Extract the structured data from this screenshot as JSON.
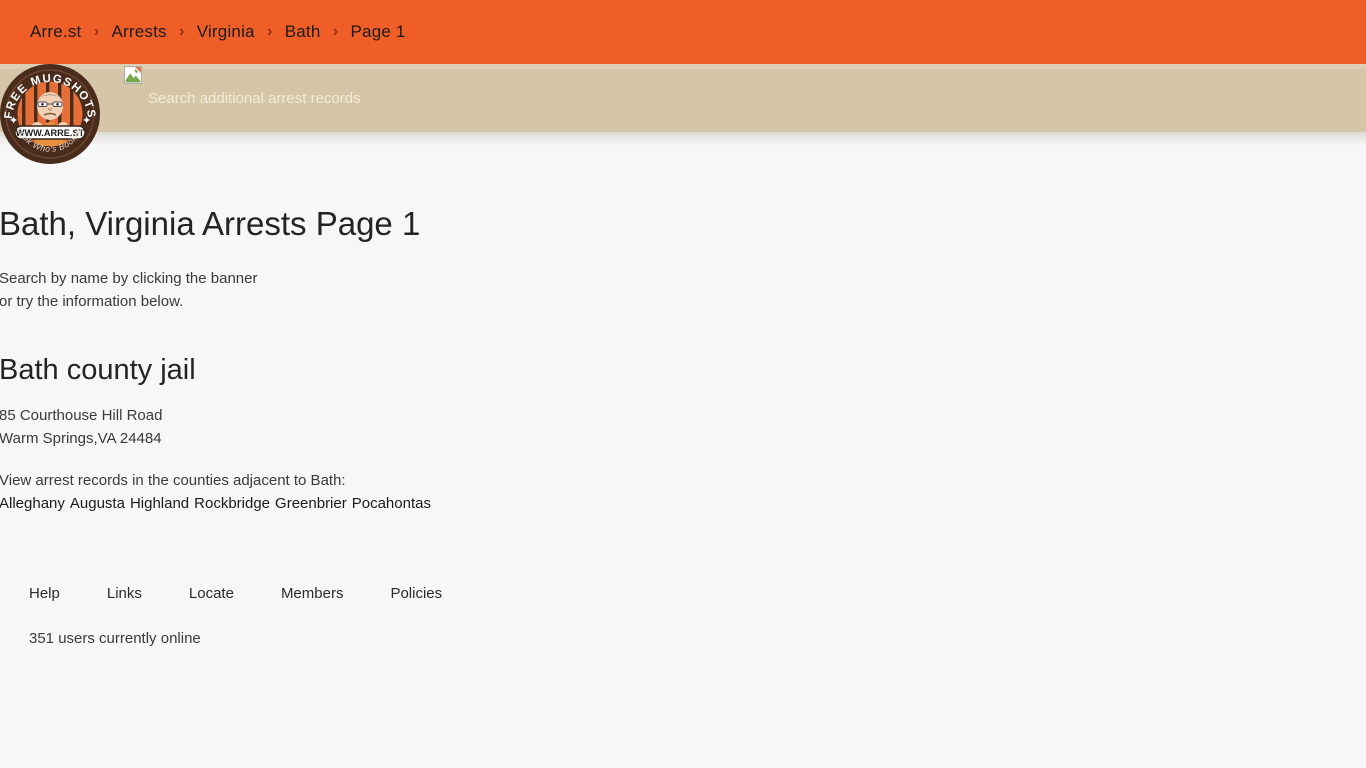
{
  "breadcrumb": {
    "separator": "›",
    "items": [
      {
        "label": "Arre.st"
      },
      {
        "label": "Arrests"
      },
      {
        "label": "Virginia"
      },
      {
        "label": "Bath"
      },
      {
        "label": "Page 1"
      }
    ]
  },
  "banner": {
    "alt_text": "Search additional arrest records",
    "icon": "broken-image-icon"
  },
  "logo": {
    "top_text": "FREE MUGSHOTS",
    "url_text": "WWW.ARRE.ST",
    "tagline": "Look Who's Booked"
  },
  "main": {
    "page_title": "Bath, Virginia Arrests Page 1",
    "lead_line_1": "Search by name by clicking the banner",
    "lead_line_2": "or try the information below.",
    "jail_name": "Bath county jail",
    "address_line_1": "85 Courthouse Hill Road",
    "address_line_2": "Warm Springs,VA 24484",
    "adjacent_label": "View arrest records in the counties adjacent to Bath:",
    "adjacent_counties": [
      "Alleghany",
      "Augusta",
      "Highland",
      "Rockbridge",
      "Greenbrier",
      "Pocahontas"
    ]
  },
  "footer": {
    "links": [
      {
        "label": "Help"
      },
      {
        "label": "Links"
      },
      {
        "label": "Locate"
      },
      {
        "label": "Members"
      },
      {
        "label": "Policies"
      }
    ],
    "users_online": "351 users currently online"
  },
  "colors": {
    "breadcrumb_bar": "#f05e28",
    "banner_band": "#d6c6a8",
    "banner_band_top": "#ddcfb3",
    "page_background": "#f7f7f7",
    "chevron": "#8e2f12",
    "text_primary": "#242428"
  }
}
